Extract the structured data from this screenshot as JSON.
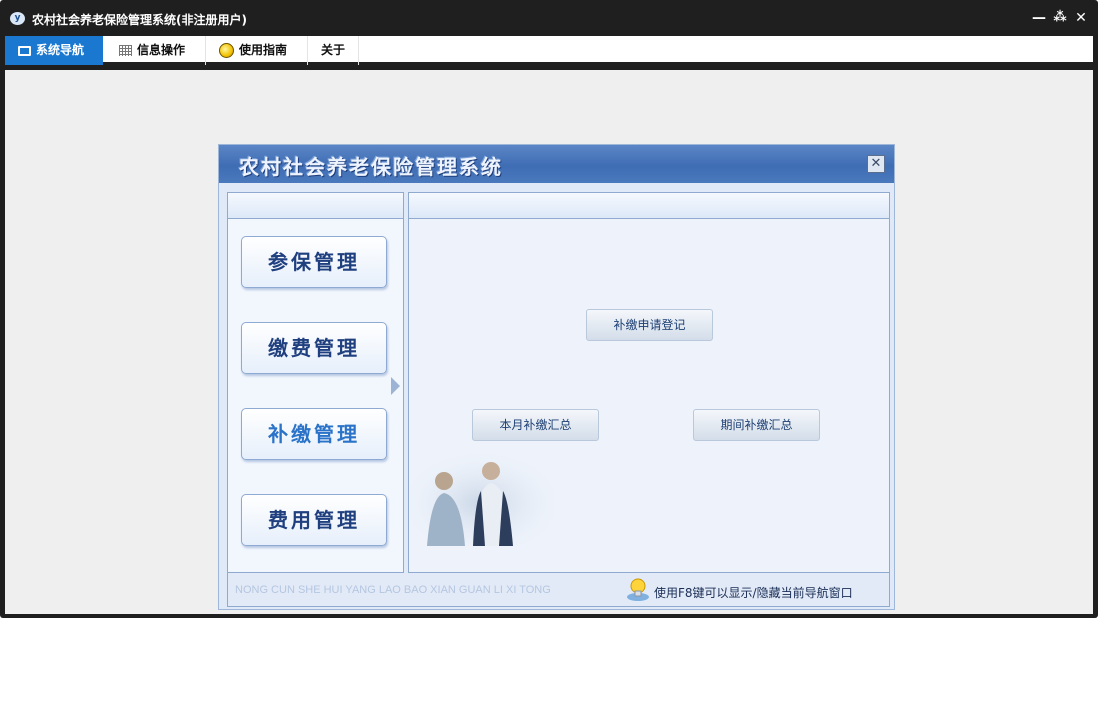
{
  "window": {
    "title": "农村社会养老保险管理系统(非注册用户)",
    "app_icon": "y",
    "controls": {
      "minimize": "—",
      "maximize": "⁂",
      "close": "✕"
    }
  },
  "menu": {
    "tabs": [
      {
        "label": "系统导航",
        "icon": "monitor-icon",
        "active": true
      },
      {
        "label": "信息操作",
        "icon": "grid-icon"
      },
      {
        "label": "使用指南",
        "icon": "bulb-icon"
      },
      {
        "label": "关于"
      }
    ]
  },
  "dialog": {
    "title": "农村社会养老保险管理系统",
    "close_label": "✕",
    "nav": [
      {
        "label": "参保管理"
      },
      {
        "label": "缴费管理"
      },
      {
        "label": "补缴管理",
        "active": true
      },
      {
        "label": "费用管理"
      }
    ],
    "actions": {
      "apply_register": "补缴申请登记",
      "monthly_summary": "本月补缴汇总",
      "period_summary": "期间补缴汇总"
    },
    "footer": {
      "pinyin": "NONG CUN SHE HUI YANG LAO BAO XIAN GUAN LI XI TONG",
      "hint": "使用F8键可以显示/隐藏当前导航窗口"
    }
  },
  "colors": {
    "title_bar": "#1f1f1f",
    "active_tab": "#1a78d0",
    "dialog_header": "#3f6db4",
    "nav_text": "#1f3f7f",
    "nav_active_text": "#2a73c8"
  }
}
